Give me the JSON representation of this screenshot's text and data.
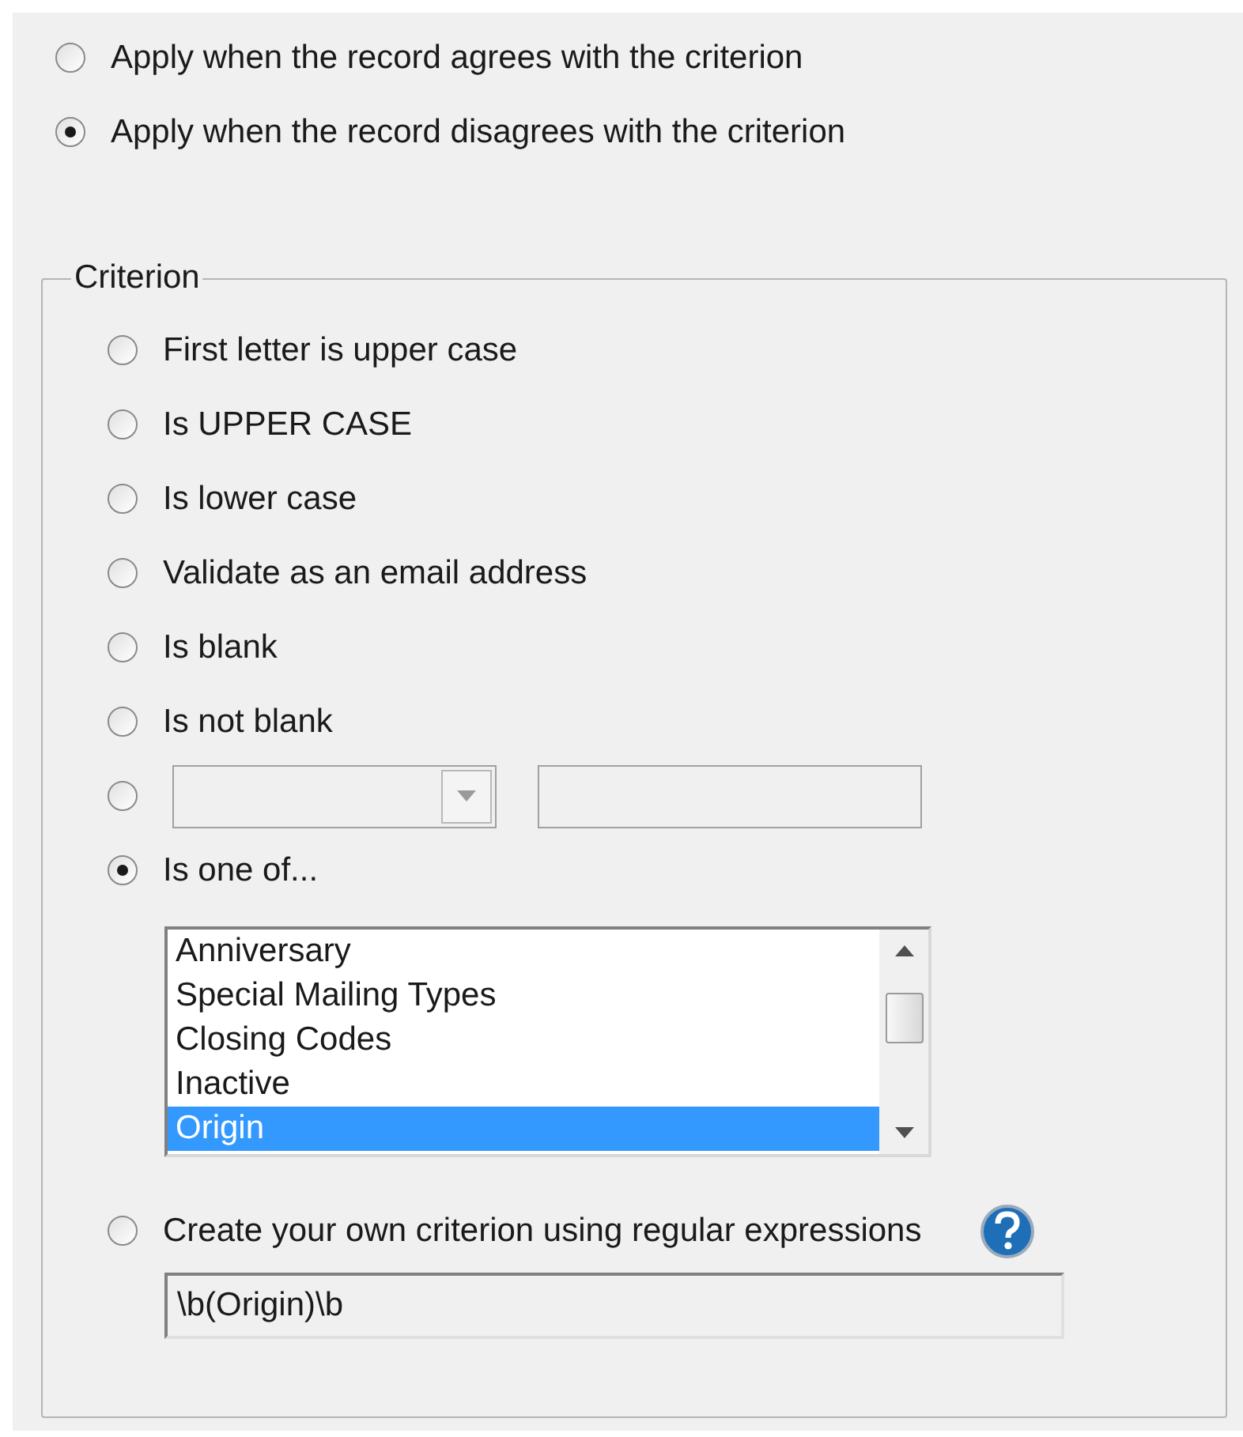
{
  "apply_options": [
    {
      "label": "Apply when the record agrees with the criterion",
      "selected": false
    },
    {
      "label": "Apply when the record disagrees with the criterion",
      "selected": true
    }
  ],
  "criterion": {
    "title": "Criterion",
    "options": [
      {
        "kind": "option",
        "label": "First letter is upper case",
        "selected": false
      },
      {
        "kind": "option",
        "label": "Is UPPER CASE",
        "selected": false
      },
      {
        "kind": "option",
        "label": "Is lower case",
        "selected": false
      },
      {
        "kind": "option",
        "label": "Validate as an email address",
        "selected": false
      },
      {
        "kind": "option",
        "label": "Is blank",
        "selected": false
      },
      {
        "kind": "option",
        "label": "Is not blank",
        "selected": false
      },
      {
        "kind": "compare",
        "selected": false
      },
      {
        "kind": "list",
        "label": "Is one of...",
        "selected": true,
        "items": [
          {
            "label": "Anniversary",
            "selected": false
          },
          {
            "label": "Special Mailing Types",
            "selected": false
          },
          {
            "label": "Closing Codes",
            "selected": false
          },
          {
            "label": "Inactive",
            "selected": false
          },
          {
            "label": "Origin",
            "selected": true
          }
        ]
      },
      {
        "kind": "regex",
        "label": "Create your own criterion using regular expressions",
        "selected": false,
        "value": "\\b(Origin)\\b"
      }
    ]
  }
}
